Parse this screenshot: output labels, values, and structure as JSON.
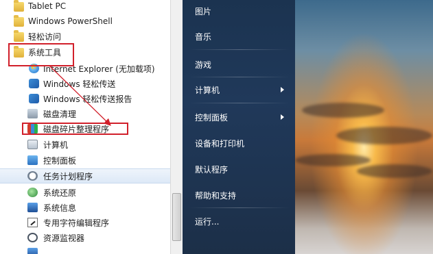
{
  "program_list": [
    {
      "label": "Tablet PC",
      "icon": "folder-icon",
      "type": "folder"
    },
    {
      "label": "Windows PowerShell",
      "icon": "folder-icon",
      "type": "folder"
    },
    {
      "label": "轻松访问",
      "icon": "folder-icon",
      "type": "folder"
    },
    {
      "label": "系统工具",
      "icon": "folder-icon",
      "type": "folder",
      "highlighted": true
    },
    {
      "label": "Internet Explorer (无加载项)",
      "icon": "internet-explorer-icon"
    },
    {
      "label": "Windows 轻松传送",
      "icon": "windows-easy-transfer-icon"
    },
    {
      "label": "Windows 轻松传送报告",
      "icon": "windows-easy-transfer-reports-icon"
    },
    {
      "label": "磁盘清理",
      "icon": "disk-cleanup-icon"
    },
    {
      "label": "磁盘碎片整理程序",
      "icon": "disk-defragmenter-icon",
      "highlighted": true
    },
    {
      "label": "计算机",
      "icon": "computer-icon"
    },
    {
      "label": "控制面板",
      "icon": "control-panel-icon"
    },
    {
      "label": "任务计划程序",
      "icon": "task-scheduler-icon",
      "selected": true
    },
    {
      "label": "系统还原",
      "icon": "system-restore-icon"
    },
    {
      "label": "系统信息",
      "icon": "system-information-icon"
    },
    {
      "label": "专用字符编辑程序",
      "icon": "private-character-editor-icon"
    },
    {
      "label": "资源监视器",
      "icon": "resource-monitor-icon"
    }
  ],
  "start_menu_right": [
    {
      "label": "图片"
    },
    {
      "label": "音乐"
    },
    {
      "label": "游戏"
    },
    {
      "label": "计算机",
      "has_submenu": true
    },
    {
      "label": "控制面板",
      "has_submenu": true
    },
    {
      "label": "设备和打印机"
    },
    {
      "label": "默认程序"
    },
    {
      "label": "帮助和支持"
    },
    {
      "label": "运行..."
    }
  ],
  "colors": {
    "highlight_border": "#d11f2a",
    "right_pane_bg": "#1b3350",
    "selected_row": "#dde9f7"
  }
}
